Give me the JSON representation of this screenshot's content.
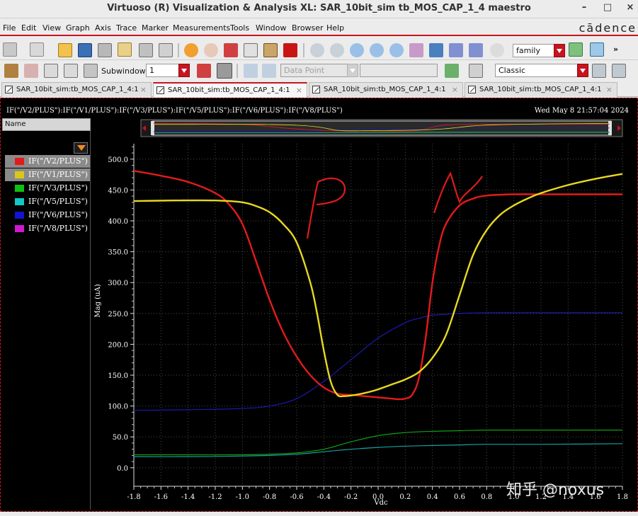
{
  "window": {
    "title": "Virtuoso (R) Visualization & Analysis XL: SAR_10bit_sim tb_MOS_CAP_1_4 maestro",
    "minimize": "–",
    "maximize": "□",
    "close": "×"
  },
  "menu": {
    "items": [
      "File",
      "Edit",
      "View",
      "Graph",
      "Axis",
      "Trace",
      "Marker",
      "Measurements",
      "Tools",
      "Window",
      "Browser",
      "Help"
    ],
    "brand": "cādence"
  },
  "toolbar1": {
    "family_value": "family",
    "more": "»"
  },
  "toolbar2": {
    "subwindow_label": "Subwindow:",
    "subwindow_value": "1",
    "data_point_value": "Data Point",
    "style_value": "Classic"
  },
  "tabs": [
    {
      "label": "SAR_10bit_sim:tb_MOS_CAP_1_4:1",
      "active": false
    },
    {
      "label": "SAR_10bit_sim:tb_MOS_CAP_1_4:1",
      "active": true
    },
    {
      "label": "SAR_10bit_sim:tb_MOS_CAP_1_4:1",
      "active": false
    },
    {
      "label": "SAR_10bit_sim:tb_MOS_CAP_1_4:1",
      "active": false
    }
  ],
  "tab_close": "×",
  "plot": {
    "header": "IF(\"/V2/PLUS\"):IF(\"/V1/PLUS\"):IF(\"/V3/PLUS\"):IF(\"/V5/PLUS\"):IF(\"/V6/PLUS\"):IF(\"/V8/PLUS\")",
    "date": "Wed May 8 21:57:04 2024",
    "legend_header": "Name",
    "annotations": {
      "p": "P",
      "n": "N"
    },
    "watermark": "知乎 @noxus"
  },
  "legend": [
    {
      "label": "IF(\"/V2/PLUS\")",
      "color": "#e31b1b",
      "selected": true
    },
    {
      "label": "IF(\"/V1/PLUS\")",
      "color": "#d8c81c",
      "selected": true
    },
    {
      "label": "IF(\"/V3/PLUS\")",
      "color": "#10c010",
      "selected": false
    },
    {
      "label": "IF(\"/V5/PLUS\")",
      "color": "#10c8c8",
      "selected": false
    },
    {
      "label": "IF(\"/V6/PLUS\")",
      "color": "#1414d0",
      "selected": false
    },
    {
      "label": "IF(\"/V8/PLUS\")",
      "color": "#d018d0",
      "selected": false
    }
  ],
  "chart_data": {
    "type": "line",
    "xlabel": "Vdc",
    "ylabel": "Mag (uA)",
    "xlim": [
      -1.8,
      1.8
    ],
    "ylim": [
      -30,
      525
    ],
    "x_ticks": [
      "-1.8",
      "-1.6",
      "-1.4",
      "-1.2",
      "-1.0",
      "-0.8",
      "-0.6",
      "-0.4",
      "-0.2",
      "0.0",
      "0.2",
      "0.4",
      "0.6",
      "0.8",
      "1.0",
      "1.2",
      "1.4",
      "1.6",
      "1.8"
    ],
    "y_ticks": [
      "0.0",
      "50.0",
      "100.0",
      "150.0",
      "200.0",
      "250.0",
      "300.0",
      "350.0",
      "400.0",
      "450.0",
      "500.0"
    ],
    "grid": true,
    "series": [
      {
        "name": "IF(\"/V2/PLUS\")",
        "color": "#e31b1b",
        "width": 2.4,
        "x": [
          -1.8,
          -1.6,
          -1.4,
          -1.2,
          -1.1,
          -1.0,
          -0.9,
          -0.8,
          -0.7,
          -0.6,
          -0.5,
          -0.4,
          -0.3,
          -0.2,
          -0.1,
          0.0,
          0.1,
          0.15,
          0.2,
          0.25,
          0.3,
          0.35,
          0.4,
          0.45,
          0.5,
          0.6,
          0.7,
          0.8,
          1.0,
          1.2,
          1.4,
          1.6,
          1.8
        ],
        "y": [
          481,
          473,
          463,
          445,
          427,
          395,
          335,
          272,
          220,
          180,
          150,
          130,
          120,
          118,
          116,
          114,
          112,
          111,
          112,
          118,
          145,
          210,
          300,
          360,
          395,
          425,
          436,
          441,
          443,
          443,
          443,
          443,
          443
        ]
      },
      {
        "name": "IF(\"/V1/PLUS\")",
        "color": "#e8d820",
        "width": 2.4,
        "x": [
          -1.8,
          -1.5,
          -1.2,
          -1.0,
          -0.9,
          -0.8,
          -0.7,
          -0.6,
          -0.5,
          -0.45,
          -0.4,
          -0.35,
          -0.3,
          -0.25,
          -0.2,
          -0.1,
          0.0,
          0.1,
          0.2,
          0.3,
          0.4,
          0.5,
          0.6,
          0.7,
          0.8,
          0.9,
          1.0,
          1.1,
          1.2,
          1.4,
          1.6,
          1.8
        ],
        "y": [
          432,
          433,
          433,
          430,
          424,
          414,
          395,
          365,
          300,
          250,
          190,
          140,
          118,
          116,
          117,
          121,
          127,
          135,
          143,
          155,
          178,
          215,
          280,
          345,
          385,
          410,
          425,
          436,
          445,
          458,
          468,
          476
        ]
      },
      {
        "name": "IF(\"/V6/PLUS\")",
        "color": "#1a1ab0",
        "width": 1.2,
        "x": [
          -1.8,
          -1.4,
          -1.0,
          -0.8,
          -0.6,
          -0.4,
          -0.2,
          0.0,
          0.2,
          0.3,
          0.4,
          0.6,
          0.8,
          1.2,
          1.8
        ],
        "y": [
          93,
          94,
          96,
          100,
          112,
          140,
          175,
          210,
          235,
          242,
          247,
          250,
          251,
          251,
          251
        ]
      },
      {
        "name": "IF(\"/V3/PLUS\")",
        "color": "#10a010",
        "width": 1.2,
        "x": [
          -1.8,
          -1.4,
          -1.0,
          -0.8,
          -0.6,
          -0.4,
          -0.2,
          0.0,
          0.2,
          0.4,
          0.6,
          0.8,
          1.2,
          1.8
        ],
        "y": [
          21,
          21,
          21,
          22,
          24,
          30,
          42,
          52,
          57,
          59,
          60,
          61,
          61,
          61
        ]
      },
      {
        "name": "IF(\"/V5/PLUS\")",
        "color": "#18a0a0",
        "width": 1.2,
        "x": [
          -1.8,
          -1.4,
          -1.0,
          -0.8,
          -0.6,
          -0.4,
          -0.2,
          0.0,
          0.2,
          0.4,
          0.6,
          0.8,
          1.2,
          1.8
        ],
        "y": [
          18,
          18,
          19,
          20,
          22,
          26,
          30,
          33,
          35,
          36,
          37,
          38,
          38,
          39
        ]
      }
    ]
  }
}
